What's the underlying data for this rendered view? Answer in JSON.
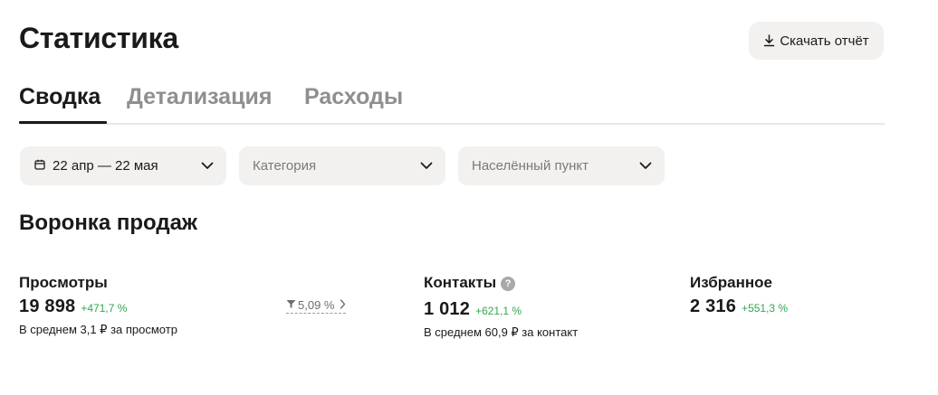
{
  "header": {
    "title": "Статистика",
    "download_label": "Скачать отчёт",
    "download_icon": "download-icon"
  },
  "tabs": [
    {
      "label": "Сводка",
      "active": true
    },
    {
      "label": "Детализация",
      "active": false
    },
    {
      "label": "Расходы",
      "active": false
    }
  ],
  "filters": {
    "date_range": {
      "value": "22 апр — 22 мая",
      "icon": "calendar-icon"
    },
    "category": {
      "placeholder": "Категория"
    },
    "location": {
      "placeholder": "Населённый пункт"
    }
  },
  "funnel": {
    "title": "Воронка продаж",
    "views": {
      "label": "Просмотры",
      "value": "19 898",
      "delta": "+471,7 %",
      "sub": "В среднем 3,1 ₽ за просмотр"
    },
    "conversion": {
      "value": "5,09 %",
      "icon": "funnel-filter-icon"
    },
    "contacts": {
      "label": "Контакты",
      "value": "1 012",
      "delta": "+621,1 %",
      "sub": "В среднем 60,9 ₽ за контакт",
      "help": "?"
    },
    "favorites": {
      "label": "Избранное",
      "value": "2 316",
      "delta": "+551,3 %"
    }
  },
  "colors": {
    "accent_green": "#2fa84f",
    "surface": "#f2f1f0",
    "text": "#1a1a1a",
    "muted": "#8f8f8f"
  }
}
